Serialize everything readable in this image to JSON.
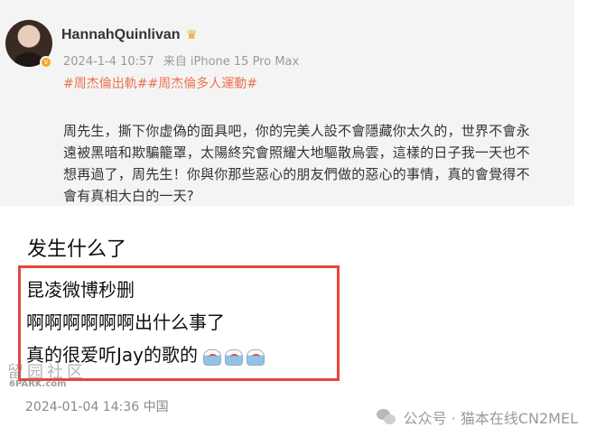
{
  "post": {
    "username": "HannahQuinlivan",
    "crown_icon": "crown-icon",
    "verify_badge": "v",
    "date": "2024-1-4 10:57",
    "source": "来自 iPhone 15 Pro Max",
    "hashtags": "#周杰倫出軌##周杰倫多人運動#",
    "body": "周先生，撕下你虚偽的面具吧，你的完美人設不會隱藏你太久的，世界不會永遠被黑暗和欺騙籠罩，太陽終究會照耀大地驅散烏雲，這樣的日子我一天也不想再過了，周先生！你與你那些惡心的朋友們做的惡心的事情，真的會覺得不會有真相大白的一天?"
  },
  "question": "发生什么了",
  "comment": {
    "line1": "昆凌微博秒删",
    "line2": "啊啊啊啊啊啊出什么事了",
    "line3": "真的很爱听Jay的歌的",
    "emoji_count": 3,
    "emoji_icon": "crying-emoji-icon",
    "timestamp": "2024-01-04 14:36",
    "location": "中国"
  },
  "watermark": {
    "logo": "留园社区",
    "url": "6PARK.com"
  },
  "source_tag": {
    "icon": "wechat-icon",
    "text": "公众号 · 猫本在线CN2MEL"
  },
  "colors": {
    "hashtag": "#eb7350",
    "highlight_border": "#e8453c",
    "meta_gray": "#9a9a9a"
  }
}
